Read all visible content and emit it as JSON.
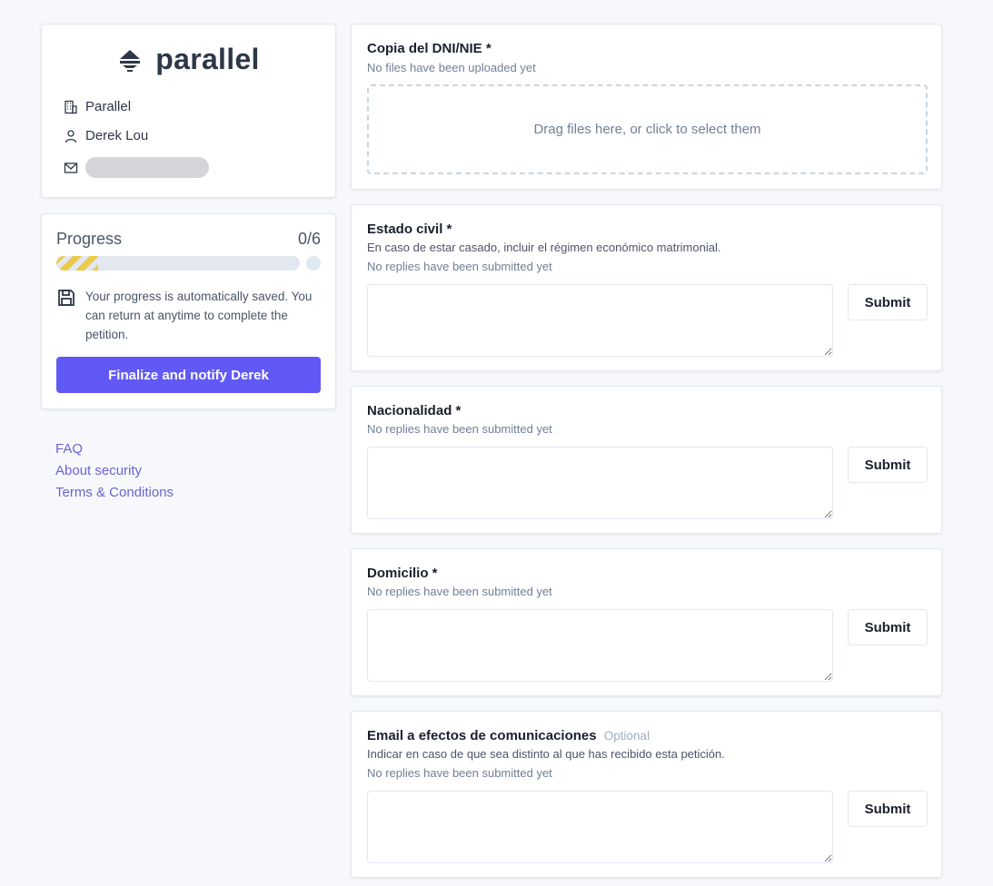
{
  "sidebar": {
    "logo": {
      "icon": "parallel-logo-icon",
      "text": "parallel"
    },
    "contact": {
      "organization": "Parallel",
      "name": "Derek Lou",
      "email_redacted": true
    },
    "progress": {
      "label": "Progress",
      "count": "0/6",
      "completed": 0,
      "total": 6,
      "fill_color": "#ecc94b",
      "save_note": "Your progress is automatically saved. You can return at anytime to complete the petition.",
      "finalize_label": "Finalize and notify Derek",
      "accent": "#6159f6"
    },
    "links": [
      "FAQ",
      "About security",
      "Terms & Conditions"
    ]
  },
  "fields": [
    {
      "title": "Copia del DNI/NIE *",
      "type": "file",
      "status": "No files have been uploaded yet",
      "dropzone": "Drag files here, or click to select them"
    },
    {
      "title": "Estado civil *",
      "type": "text",
      "description": "En caso de estar casado, incluir el régimen económico matrimonial.",
      "status": "No replies have been submitted yet",
      "value": "",
      "submit_label": "Submit"
    },
    {
      "title": "Nacionalidad *",
      "type": "text",
      "status": "No replies have been submitted yet",
      "value": "",
      "submit_label": "Submit"
    },
    {
      "title": "Domicilio *",
      "type": "text",
      "status": "No replies have been submitted yet",
      "value": "",
      "submit_label": "Submit"
    },
    {
      "title": "Email a efectos de comunicaciones",
      "optional_label": "Optional",
      "type": "text",
      "description": "Indicar en caso de que sea distinto al que has recibido esta petición.",
      "status": "No replies have been submitted yet",
      "value": "",
      "submit_label": "Submit"
    }
  ]
}
